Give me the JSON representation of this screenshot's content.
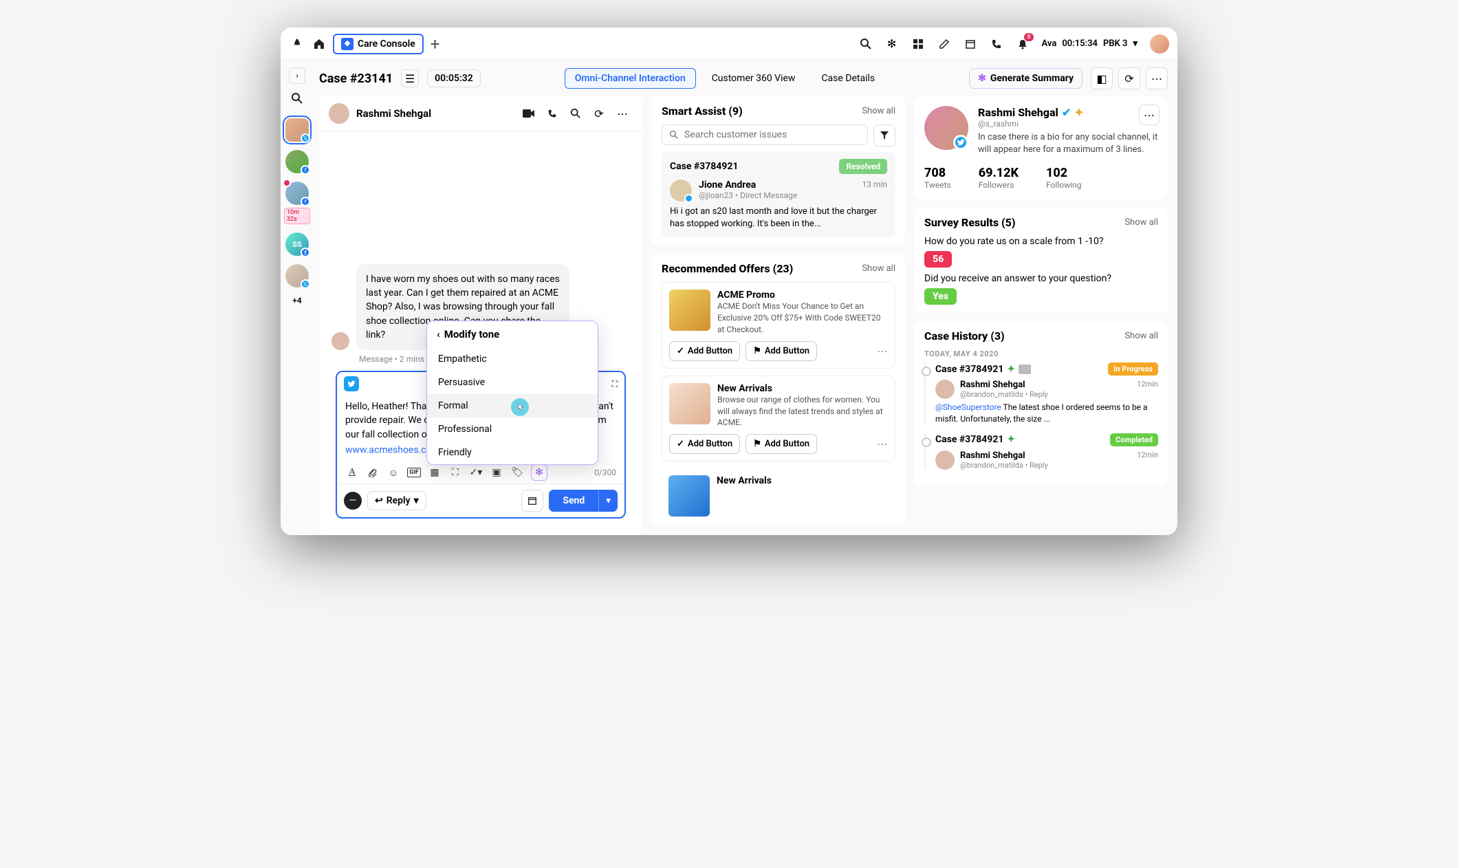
{
  "topbar": {
    "tab_label": "Care Console",
    "user_name": "Ava",
    "timer": "00:15:34",
    "status": "PBK 3",
    "bell_count": "8"
  },
  "header": {
    "case": "Case #23141",
    "timer": "00:05:32",
    "tabs": [
      "Omni-Channel Interaction",
      "Customer 360 View",
      "Case Details"
    ],
    "generate": "Generate Summary"
  },
  "rail": {
    "time_badge": "10m 32s",
    "ss": "SS",
    "more": "+4"
  },
  "chat": {
    "name": "Rashmi Shehgal",
    "message": "I have worn my shoes out with so many races last year. Can I get them repaired at an ACME Shop? Also, I was browsing through your fall shoe collection online. Can you share the link?",
    "meta": "Message • 2 mins ago",
    "compose_text_1": "Hello, Heather! Thanks for reaching out. Unfortunately, we can't provide repair. We can give you a discount on a ",
    "compose_text_2": "new pair from our fall collection of shoes: ",
    "compose_link": "www.acmeshoes.com/fallcollection.",
    "char_count": "0/300",
    "reply": "Reply",
    "send": "Send"
  },
  "tone": {
    "title": "Modify tone",
    "options": [
      "Empathetic",
      "Persuasive",
      "Formal",
      "Professional",
      "Friendly"
    ]
  },
  "smart_assist": {
    "title": "Smart Assist (9)",
    "show_all": "Show all",
    "search_placeholder": "Search customer issues",
    "case": "Case #3784921",
    "status": "Resolved",
    "user_name": "Jione Andrea",
    "user_handle": "@jioan23 • Direct Message",
    "time": "13 min",
    "body": "Hi i got an s20 last month and love it but the charger has stopped working.  It's been in the..."
  },
  "offers": {
    "title": "Recommended Offers (23)",
    "show_all": "Show all",
    "items": [
      {
        "title": "ACME Promo",
        "desc": "ACME Don't Miss Your Chance to Get an Exclusive 20% Off $75+ With Code SWEET20 at Checkout."
      },
      {
        "title": "New Arrivals",
        "desc": "Browse our range of clothes for women. You will always find the latest trends and styles at ACME."
      },
      {
        "title": "New Arrivals",
        "desc": ""
      }
    ],
    "add_btn": "Add Button"
  },
  "profile": {
    "name": "Rashmi Shehgal",
    "handle": "@s_rashmi",
    "bio": "In case there is a bio for any social channel, it will appear here for a maximum of 3 lines.",
    "stats": [
      {
        "val": "708",
        "lbl": "Tweets"
      },
      {
        "val": "69.12K",
        "lbl": "Followers"
      },
      {
        "val": "102",
        "lbl": "Following"
      }
    ]
  },
  "survey": {
    "title": "Survey Results (5)",
    "show_all": "Show all",
    "q1": "How do you rate us on a scale from 1 -10?",
    "a1": "56",
    "q2": "Did you receive an answer to your question?",
    "a2": "Yes"
  },
  "history": {
    "title": "Case History (3)",
    "show_all": "Show all",
    "date": "TODAY, MAY 4 2020",
    "items": [
      {
        "case": "Case #3784921",
        "badge": "In Progress",
        "badge_class": "prog",
        "name": "Rashmi Shehgal",
        "handle": "@brandon_matilda • Reply",
        "time": "12min",
        "mention": "@ShoeSuperstore",
        "body": " The latest shoe I ordered seems to be a misfit. Unfortunately, the size ..."
      },
      {
        "case": "Case #3784921",
        "badge": "Completed",
        "badge_class": "comp",
        "name": "Rashmi Shehgal",
        "handle": "@brandon_matilda • Reply",
        "time": "12min",
        "mention": "",
        "body": ""
      }
    ]
  }
}
